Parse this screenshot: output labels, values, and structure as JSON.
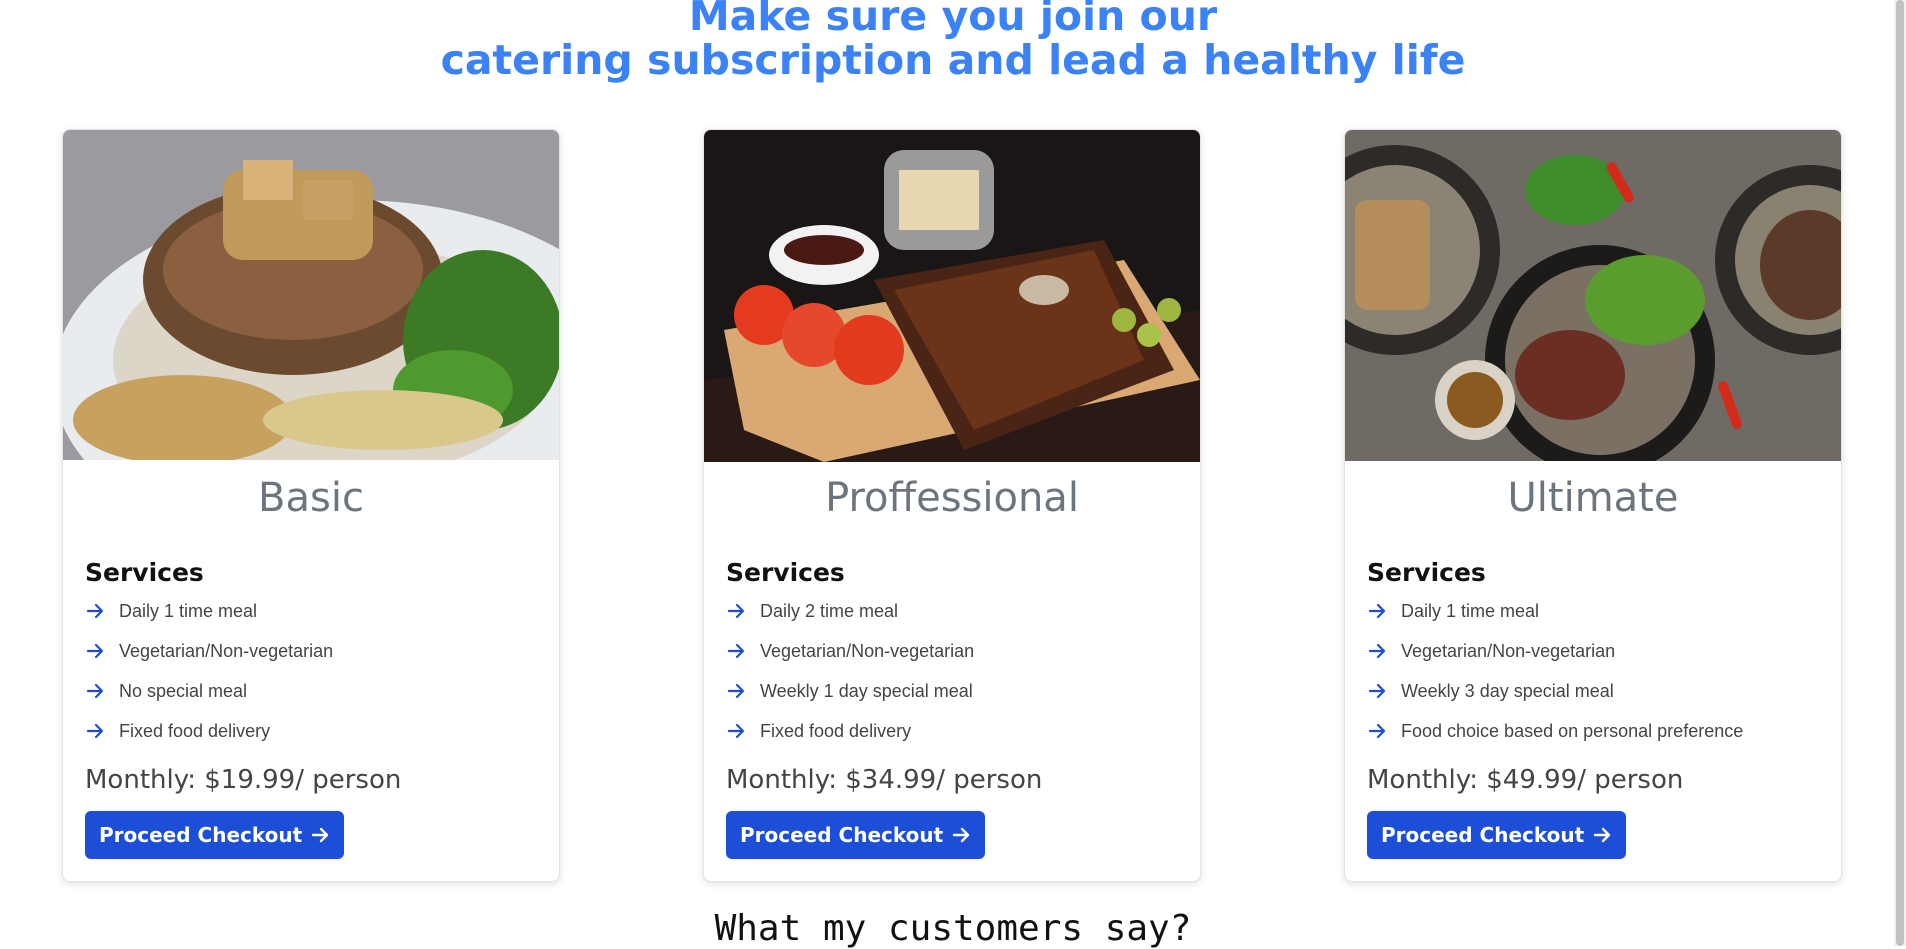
{
  "header": {
    "line1": "Make sure you join our",
    "line2": "catering subscription and lead a healthy life"
  },
  "cards": [
    {
      "title": "Basic",
      "image": "grilled-pork-chop-with-broccoli",
      "services_title": "Services",
      "services": [
        "Daily 1 time meal",
        "Vegetarian/Non-vegetarian",
        "No special meal",
        "Fixed food delivery"
      ],
      "price": "Monthly: $19.99/ person",
      "button": "Proceed Checkout"
    },
    {
      "title": "Proffessional",
      "image": "bbq-ribs-with-tomatoes-and-fries",
      "services_title": "Services",
      "services": [
        "Daily 2 time meal",
        "Vegetarian/Non-vegetarian",
        "Weekly 1 day special meal",
        "Fixed food delivery"
      ],
      "price": "Monthly: $34.99/ person",
      "button": "Proceed Checkout"
    },
    {
      "title": "Ultimate",
      "image": "steak-salad-bowls-on-wooden-table",
      "services_title": "Services",
      "services": [
        "Daily 1 time meal",
        "Vegetarian/Non-vegetarian",
        "Weekly 3 day special meal",
        "Food choice based on personal preference"
      ],
      "price": "Monthly: $49.99/ person",
      "button": "Proceed Checkout"
    }
  ],
  "testimonials": {
    "title": "What my customers say?"
  },
  "colors": {
    "accent": "#3b82f6",
    "button": "#1d4ed8",
    "muted": "#6c757d"
  },
  "icons": {
    "list_bullet": "arrow-right-icon",
    "button_icon": "arrow-right-icon"
  }
}
